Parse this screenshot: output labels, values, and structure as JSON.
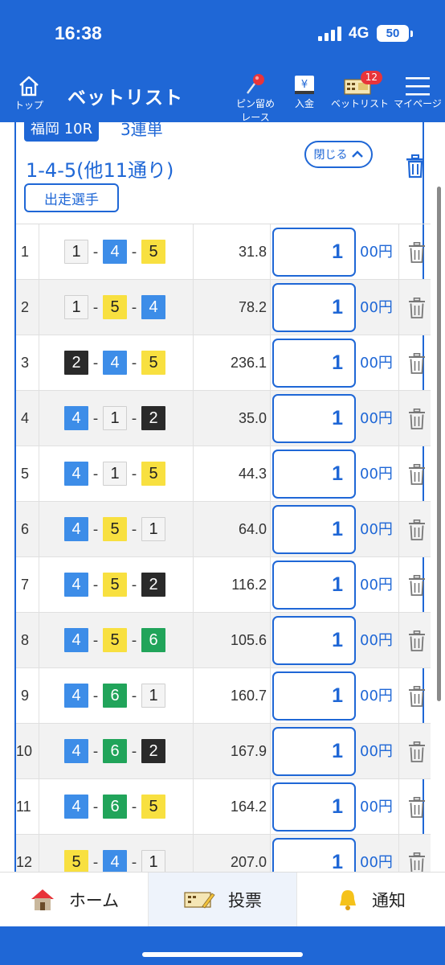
{
  "status_bar": {
    "time": "16:38",
    "network": "4G",
    "battery": "50"
  },
  "header": {
    "home_label": "トップ",
    "title": "ベットリスト",
    "nav": [
      {
        "id": "pin",
        "label_line1": "ピン留め",
        "label_line2": "レース"
      },
      {
        "id": "deposit",
        "label": "入金"
      },
      {
        "id": "betlist",
        "label": "ベットリスト",
        "badge": "12"
      },
      {
        "id": "mypage",
        "label": "マイページ"
      }
    ]
  },
  "race": {
    "venue_race": "福岡 10R",
    "bet_type": "3連単",
    "combo_title": "1-4-5(他11通り)",
    "close_label": "閉じる",
    "runners_label": "出走選手"
  },
  "bets": [
    {
      "no": "1",
      "combo": [
        "1",
        "4",
        "5"
      ],
      "odds": "31.8",
      "amount": "1",
      "unit": "00円"
    },
    {
      "no": "2",
      "combo": [
        "1",
        "5",
        "4"
      ],
      "odds": "78.2",
      "amount": "1",
      "unit": "00円"
    },
    {
      "no": "3",
      "combo": [
        "2",
        "4",
        "5"
      ],
      "odds": "236.1",
      "amount": "1",
      "unit": "00円"
    },
    {
      "no": "4",
      "combo": [
        "4",
        "1",
        "2"
      ],
      "odds": "35.0",
      "amount": "1",
      "unit": "00円"
    },
    {
      "no": "5",
      "combo": [
        "4",
        "1",
        "5"
      ],
      "odds": "44.3",
      "amount": "1",
      "unit": "00円"
    },
    {
      "no": "6",
      "combo": [
        "4",
        "5",
        "1"
      ],
      "odds": "64.0",
      "amount": "1",
      "unit": "00円"
    },
    {
      "no": "7",
      "combo": [
        "4",
        "5",
        "2"
      ],
      "odds": "116.2",
      "amount": "1",
      "unit": "00円"
    },
    {
      "no": "8",
      "combo": [
        "4",
        "5",
        "6"
      ],
      "odds": "105.6",
      "amount": "1",
      "unit": "00円"
    },
    {
      "no": "9",
      "combo": [
        "4",
        "6",
        "1"
      ],
      "odds": "160.7",
      "amount": "1",
      "unit": "00円"
    },
    {
      "no": "10",
      "combo": [
        "4",
        "6",
        "2"
      ],
      "odds": "167.9",
      "amount": "1",
      "unit": "00円"
    },
    {
      "no": "11",
      "combo": [
        "4",
        "6",
        "5"
      ],
      "odds": "164.2",
      "amount": "1",
      "unit": "00円"
    },
    {
      "no": "12",
      "combo": [
        "5",
        "4",
        "1"
      ],
      "odds": "207.0",
      "amount": "1",
      "unit": "00円"
    }
  ],
  "bottom_nav": [
    {
      "id": "home",
      "label": "ホーム"
    },
    {
      "id": "vote",
      "label": "投票"
    },
    {
      "id": "notify",
      "label": "通知"
    }
  ],
  "colors": {
    "primary": "#1f67d6",
    "runner_1": "#f4f4f4",
    "runner_2": "#2a2a2a",
    "runner_4": "#3d8de8",
    "runner_5": "#f8e040",
    "runner_6": "#21a45a"
  }
}
